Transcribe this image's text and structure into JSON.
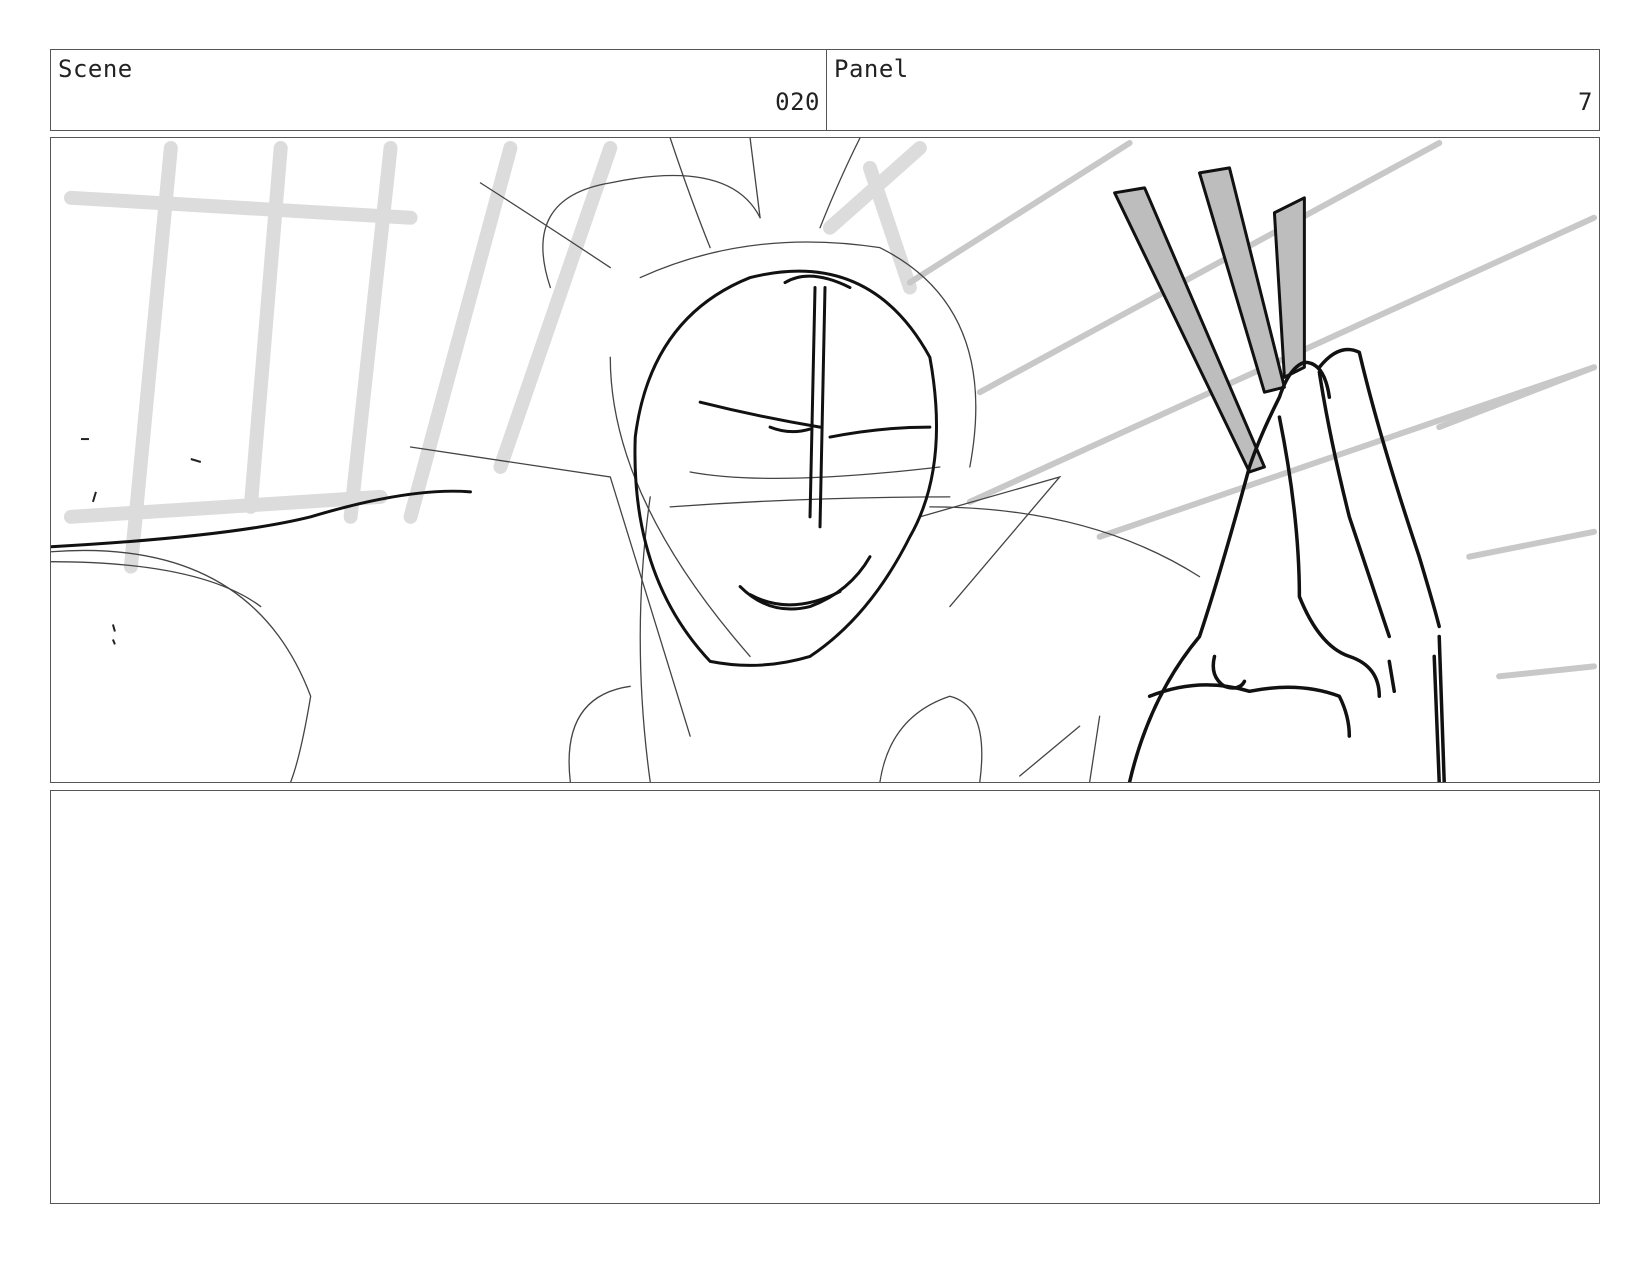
{
  "scene": {
    "label": "Scene",
    "number": "020"
  },
  "panel": {
    "label": "Panel",
    "number": "7"
  },
  "drawing": {
    "description_icon": "storyboard-sketch",
    "line_color": "#111111",
    "tone_color": "#bdbdbd",
    "speedline_color": "#d4d4d4"
  },
  "notes": {
    "text": ""
  }
}
